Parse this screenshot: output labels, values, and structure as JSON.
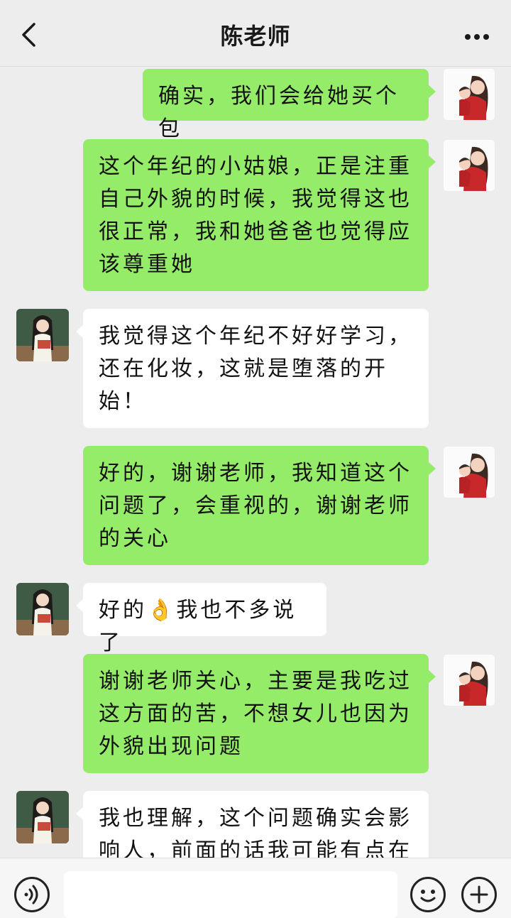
{
  "header": {
    "title": "陈老师",
    "back_icon": "chevron-left-icon",
    "more_icon": "more-dots-icon"
  },
  "messages": [
    {
      "sender": "self",
      "text": "确实，我们会给她买个包"
    },
    {
      "sender": "self",
      "text": "这个年纪的小姑娘，正是注重自己外貌的时候，我觉得这也很正常，我和她爸爸也觉得应该尊重她"
    },
    {
      "sender": "teacher",
      "text": "我觉得这个年纪不好好学习，还在化妆，这就是堕落的开始！"
    },
    {
      "sender": "self",
      "text": "好的，谢谢老师，我知道这个问题了，会重视的，谢谢老师的关心"
    },
    {
      "sender": "teacher",
      "text_before": "好的",
      "emoji": "👌",
      "text_after": "我也不多说了"
    },
    {
      "sender": "self",
      "text": "谢谢老师关心，主要是我吃过这方面的苦，不想女儿也因为外貌出现问题"
    },
    {
      "sender": "teacher",
      "text": "我也理解，这个问题确实会影响人，前面的话我可能有点在"
    }
  ],
  "input_bar": {
    "voice_icon": "voice-icon",
    "emoji_icon": "emoji-face-icon",
    "plus_icon": "plus-icon",
    "input_value": ""
  },
  "colors": {
    "background": "#ededed",
    "bubble_self": "#95ec69",
    "bubble_other": "#ffffff"
  }
}
